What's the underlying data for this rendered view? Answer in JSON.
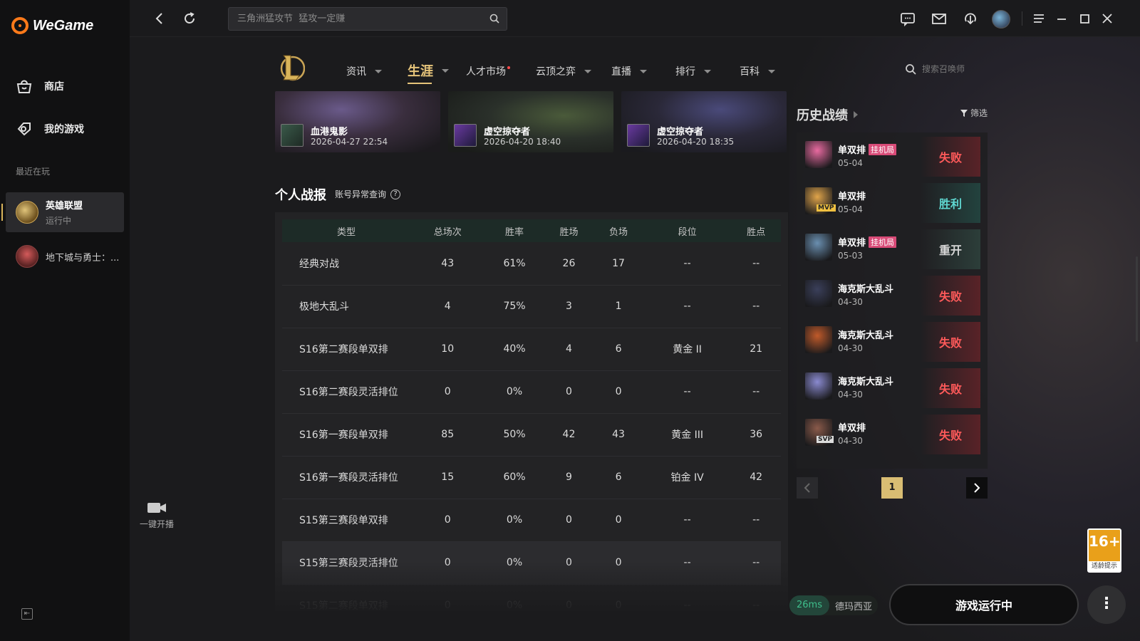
{
  "app": {
    "brand": "WeGame"
  },
  "sidebar": {
    "nav": [
      {
        "label": "商店",
        "icon": "store-icon"
      },
      {
        "label": "我的游戏",
        "icon": "games-icon"
      }
    ],
    "recent_title": "最近在玩",
    "recent": [
      {
        "name": "英雄联盟",
        "status": "运行中"
      },
      {
        "name": "地下城与勇士：...",
        "status": ""
      }
    ],
    "collapse": "⇤"
  },
  "topbar": {
    "search_placeholder": "三角洲猛攻节  猛攻一定赚"
  },
  "game_nav": {
    "items": [
      {
        "label": "资讯"
      },
      {
        "label": "生涯"
      },
      {
        "label": "人才市场"
      },
      {
        "label": "云顶之弈"
      },
      {
        "label": "直播"
      },
      {
        "label": "排行"
      },
      {
        "label": "百科"
      }
    ],
    "summoner_search_placeholder": "搜索召唤师"
  },
  "highlights": [
    {
      "title": "血港鬼影",
      "date": "2026-04-27 22:54"
    },
    {
      "title": "虚空掠夺者",
      "date": "2026-04-20 18:40"
    },
    {
      "title": "虚空掠夺者",
      "date": "2026-04-20 18:35"
    }
  ],
  "stats": {
    "title": "个人战报",
    "account_check": "账号异常查询",
    "columns": [
      "类型",
      "总场次",
      "胜率",
      "胜场",
      "负场",
      "段位",
      "胜点"
    ],
    "rows": [
      [
        "经典对战",
        "43",
        "61%",
        "26",
        "17",
        "--",
        "--"
      ],
      [
        "极地大乱斗",
        "4",
        "75%",
        "3",
        "1",
        "--",
        "--"
      ],
      [
        "S16第二赛段单双排",
        "10",
        "40%",
        "4",
        "6",
        "黄金 II",
        "21"
      ],
      [
        "S16第二赛段灵活排位",
        "0",
        "0%",
        "0",
        "0",
        "--",
        "--"
      ],
      [
        "S16第一赛段单双排",
        "85",
        "50%",
        "42",
        "43",
        "黄金 III",
        "36"
      ],
      [
        "S16第一赛段灵活排位",
        "15",
        "60%",
        "9",
        "6",
        "铂金 IV",
        "42"
      ],
      [
        "S15第三赛段单双排",
        "0",
        "0%",
        "0",
        "0",
        "--",
        "--"
      ],
      [
        "S15第三赛段灵活排位",
        "0",
        "0%",
        "0",
        "0",
        "--",
        "--"
      ],
      [
        "S15第二赛段单双排",
        "0",
        "0%",
        "0",
        "0",
        "--",
        "--"
      ]
    ]
  },
  "history": {
    "title": "历史战绩",
    "filter": "筛选",
    "matches": [
      {
        "mode": "单双排",
        "tag": "挂机局",
        "date": "05-04",
        "result": "失败",
        "type": "lose",
        "badge": "",
        "color": "#e86aa0"
      },
      {
        "mode": "单双排",
        "tag": "",
        "date": "05-04",
        "result": "胜利",
        "type": "win",
        "badge": "MVP",
        "color": "#e0a44a"
      },
      {
        "mode": "单双排",
        "tag": "挂机局",
        "date": "05-03",
        "result": "重开",
        "type": "remake",
        "badge": "",
        "color": "#6a8fb0"
      },
      {
        "mode": "海克斯大乱斗",
        "tag": "",
        "date": "04-30",
        "result": "失败",
        "type": "lose",
        "badge": "",
        "color": "#3a3f5a"
      },
      {
        "mode": "海克斯大乱斗",
        "tag": "",
        "date": "04-30",
        "result": "失败",
        "type": "lose",
        "badge": "",
        "color": "#c05a2a"
      },
      {
        "mode": "海克斯大乱斗",
        "tag": "",
        "date": "04-30",
        "result": "失败",
        "type": "lose",
        "badge": "",
        "color": "#8a8ad0"
      },
      {
        "mode": "单双排",
        "tag": "",
        "date": "04-30",
        "result": "失败",
        "type": "lose",
        "badge": "SVP",
        "color": "#8a5a4a"
      }
    ],
    "page": "1"
  },
  "bottom": {
    "live_label": "一键开播",
    "ping": "26ms",
    "server": "德玛西亚",
    "run_label": "游戏运行中",
    "more": "⋮",
    "age_rating": "16+",
    "age_sub": "适龄提示"
  }
}
